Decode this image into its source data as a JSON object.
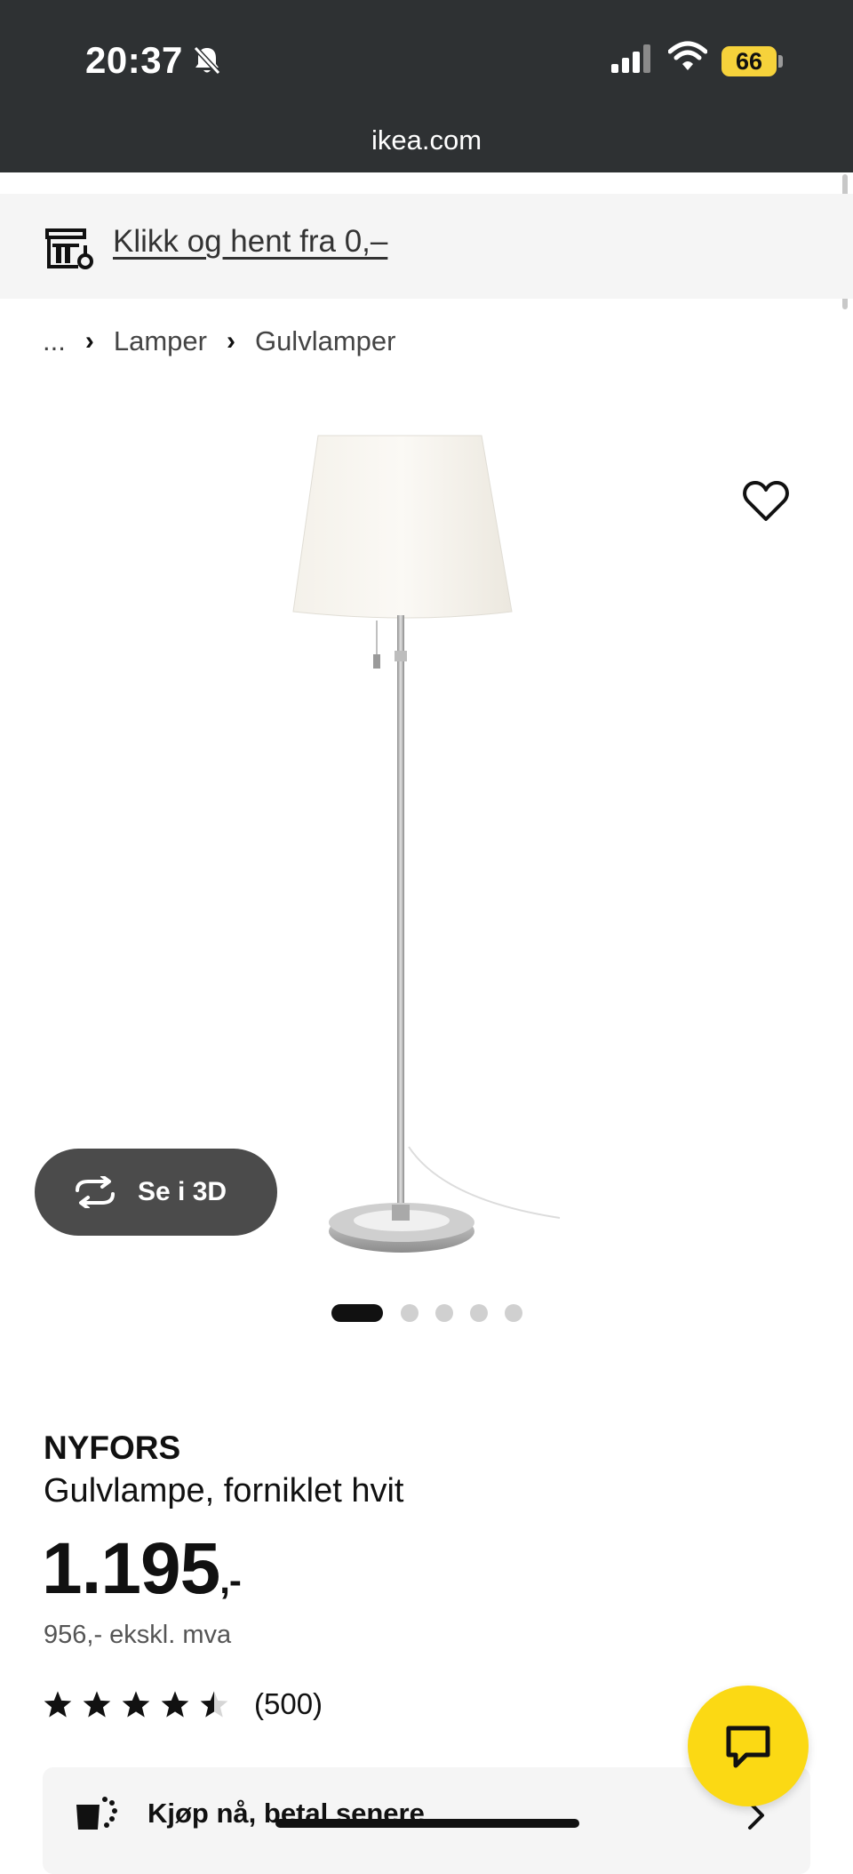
{
  "status_bar": {
    "time": "20:37",
    "battery": "66",
    "battery_color": "#f6d23b"
  },
  "browser": {
    "url": "ikea.com"
  },
  "promo": {
    "link_text": "Klikk og hent fra 0,–",
    "icon": "store-pickup-icon"
  },
  "breadcrumb": {
    "ellipsis": "...",
    "items": [
      "Lamper",
      "Gulvlamper"
    ]
  },
  "gallery": {
    "view_3d_label": "Se i 3D",
    "slide_count": 5,
    "active_slide": 1
  },
  "product": {
    "brand": "NYFORS",
    "description": "Gulvlampe, forniklet hvit",
    "price": "1.195",
    "price_suffix": ",-",
    "price_ex_vat": "956,- ekskl. mva",
    "rating": 4.5,
    "rating_max": 5,
    "review_count": "(500)"
  },
  "payment": {
    "label": "Kjøp nå, betal senere",
    "icon": "payment-icon"
  },
  "colors": {
    "top_bar": "#2e3133",
    "chat_button": "#fbd914",
    "promo_background": "#f5f5f5",
    "view3d_button": "#4b4b4b"
  }
}
